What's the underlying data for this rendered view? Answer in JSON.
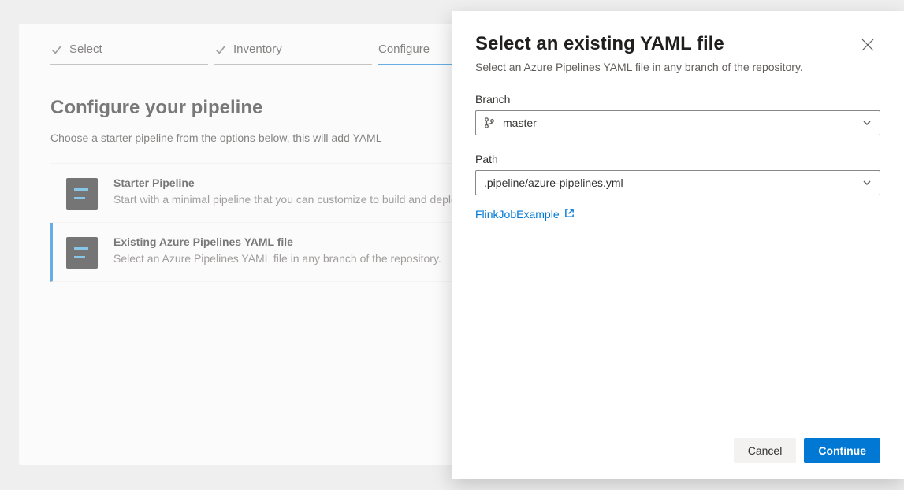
{
  "wizard": {
    "steps": [
      {
        "label": "Select",
        "done": true
      },
      {
        "label": "Inventory",
        "done": true
      },
      {
        "label": "Configure",
        "active": true
      },
      {
        "label": "",
        "plain": true
      }
    ]
  },
  "page": {
    "title": "Configure your pipeline",
    "subtitle": "Choose a starter pipeline from the options below, this will add YAML"
  },
  "options": [
    {
      "title": "Starter Pipeline",
      "desc": "Start with a minimal pipeline that you can customize to build and deploy your code.",
      "selected": false
    },
    {
      "title": "Existing Azure Pipelines YAML file",
      "desc": "Select an Azure Pipelines YAML file in any branch of the repository.",
      "selected": true
    }
  ],
  "panel": {
    "title": "Select an existing YAML file",
    "subtitle": "Select an Azure Pipelines YAML file in any branch of the repository.",
    "branch_label": "Branch",
    "branch_value": "master",
    "path_label": "Path",
    "path_value": ".pipeline/azure-pipelines.yml",
    "link_text": "FlinkJobExample",
    "cancel_label": "Cancel",
    "continue_label": "Continue"
  }
}
